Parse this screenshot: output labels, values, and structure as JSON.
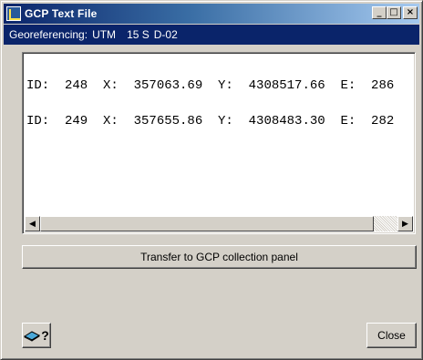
{
  "window": {
    "title": "GCP Text File",
    "controls": {
      "minimize": "_",
      "maximize": "□",
      "close": "×"
    }
  },
  "info": {
    "label": "Georeferencing:",
    "projection": "UTM",
    "zone": "15 S",
    "datum": "D-02"
  },
  "text_lines": [
    "ID:  248  X:  357063.69  Y:  4308517.66  E:  286",
    "ID:  249  X:  357655.86  Y:  4308483.30  E:  282"
  ],
  "scrollbar": {
    "left_arrow": "◀",
    "right_arrow": "▶"
  },
  "buttons": {
    "transfer": "Transfer to GCP collection panel",
    "close": "Close",
    "help_mark": "?"
  },
  "icons": {
    "help": "book-help-icon",
    "app": "app-icon"
  }
}
